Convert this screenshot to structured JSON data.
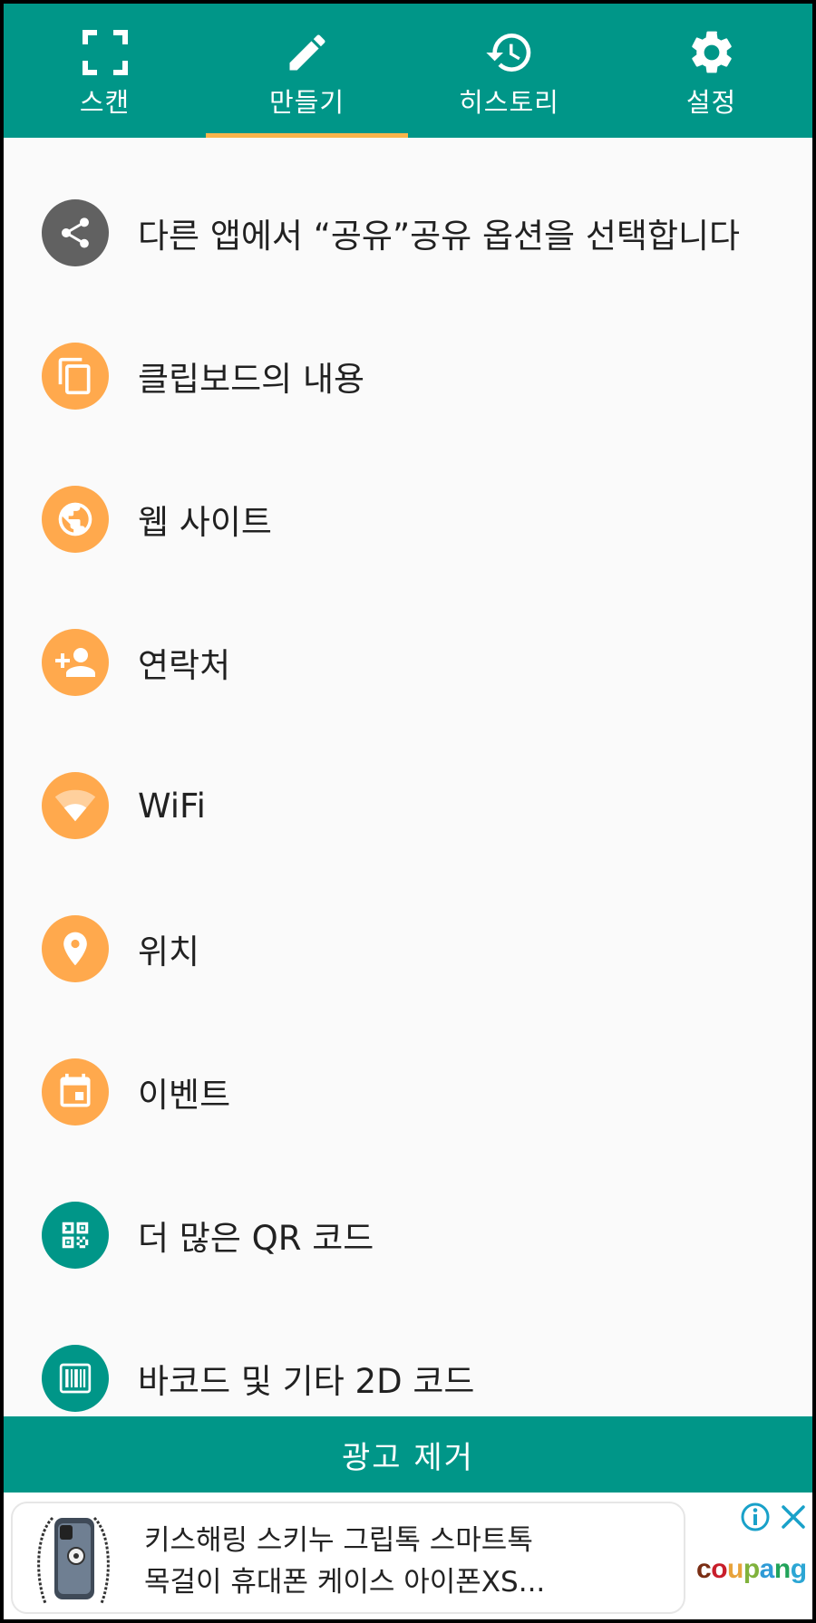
{
  "tabs": [
    {
      "label": "스캔",
      "icon": "scan-frame-icon",
      "active": false
    },
    {
      "label": "만들기",
      "icon": "pencil-icon",
      "active": true
    },
    {
      "label": "히스토리",
      "icon": "history-icon",
      "active": false
    },
    {
      "label": "설정",
      "icon": "gear-icon",
      "active": false
    }
  ],
  "items": [
    {
      "label": "다른 앱에서 “공유”공유 옵션을 선택합니다",
      "icon": "share-icon",
      "color": "#616161"
    },
    {
      "label": "클립보드의 내용",
      "icon": "clipboard-copy-icon",
      "color": "#ffa94d"
    },
    {
      "label": "웹 사이트",
      "icon": "globe-icon",
      "color": "#ffa94d"
    },
    {
      "label": "연락처",
      "icon": "add-contact-icon",
      "color": "#ffa94d"
    },
    {
      "label": "WiFi",
      "icon": "wifi-icon",
      "color": "#ffa94d"
    },
    {
      "label": "위치",
      "icon": "location-pin-icon",
      "color": "#ffa94d"
    },
    {
      "label": "이벤트",
      "icon": "calendar-icon",
      "color": "#ffa94d"
    },
    {
      "label": "더 많은 QR 코드",
      "icon": "qr-code-icon",
      "color": "#009688"
    },
    {
      "label": "바코드 및 기타 2D 코드",
      "icon": "barcode-icon",
      "color": "#009688"
    }
  ],
  "remove_ads": "광고 제거",
  "ad": {
    "title_line1": "키스해링 스키누 그립톡 스마트톡",
    "title_line2": "목걸이 휴대폰 케이스 아이폰XS...",
    "brand_parts": [
      "c",
      "o",
      "u",
      "p",
      "a",
      "n",
      "g"
    ],
    "brand_colors": [
      "#7a2e14",
      "#c81e2b",
      "#e8a33b",
      "#80b23c",
      "#2f9bd6",
      "#22a35a",
      "#2ca6d4"
    ],
    "info_icon": "info-icon",
    "close_icon": "close-icon",
    "accent": "#19a1c9"
  },
  "colors": {
    "primary": "#009688",
    "accent_orange": "#ffa94d",
    "tab_indicator": "#f9b44a"
  }
}
